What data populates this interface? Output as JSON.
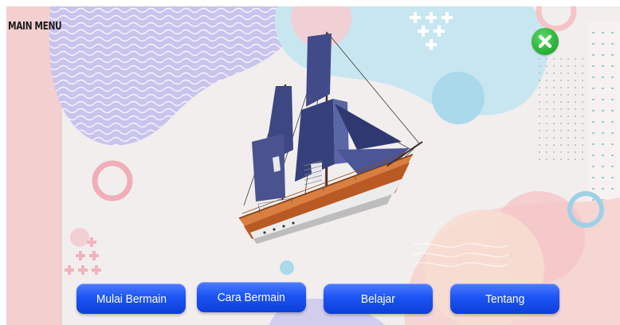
{
  "header": {
    "title": "MAIN MENU"
  },
  "close_button": {
    "icon": "close-icon",
    "color": "#2fb63e"
  },
  "illustration": {
    "subject": "ship-icon"
  },
  "menu": {
    "buttons": [
      {
        "label": "Mulai Bermain"
      },
      {
        "label": "Cara Bermain"
      },
      {
        "label": "Belajar"
      },
      {
        "label": "Tentang"
      }
    ]
  },
  "colors": {
    "button": "#1c54f4",
    "button_text": "#ffffff",
    "title_text": "#1d1d1d"
  }
}
